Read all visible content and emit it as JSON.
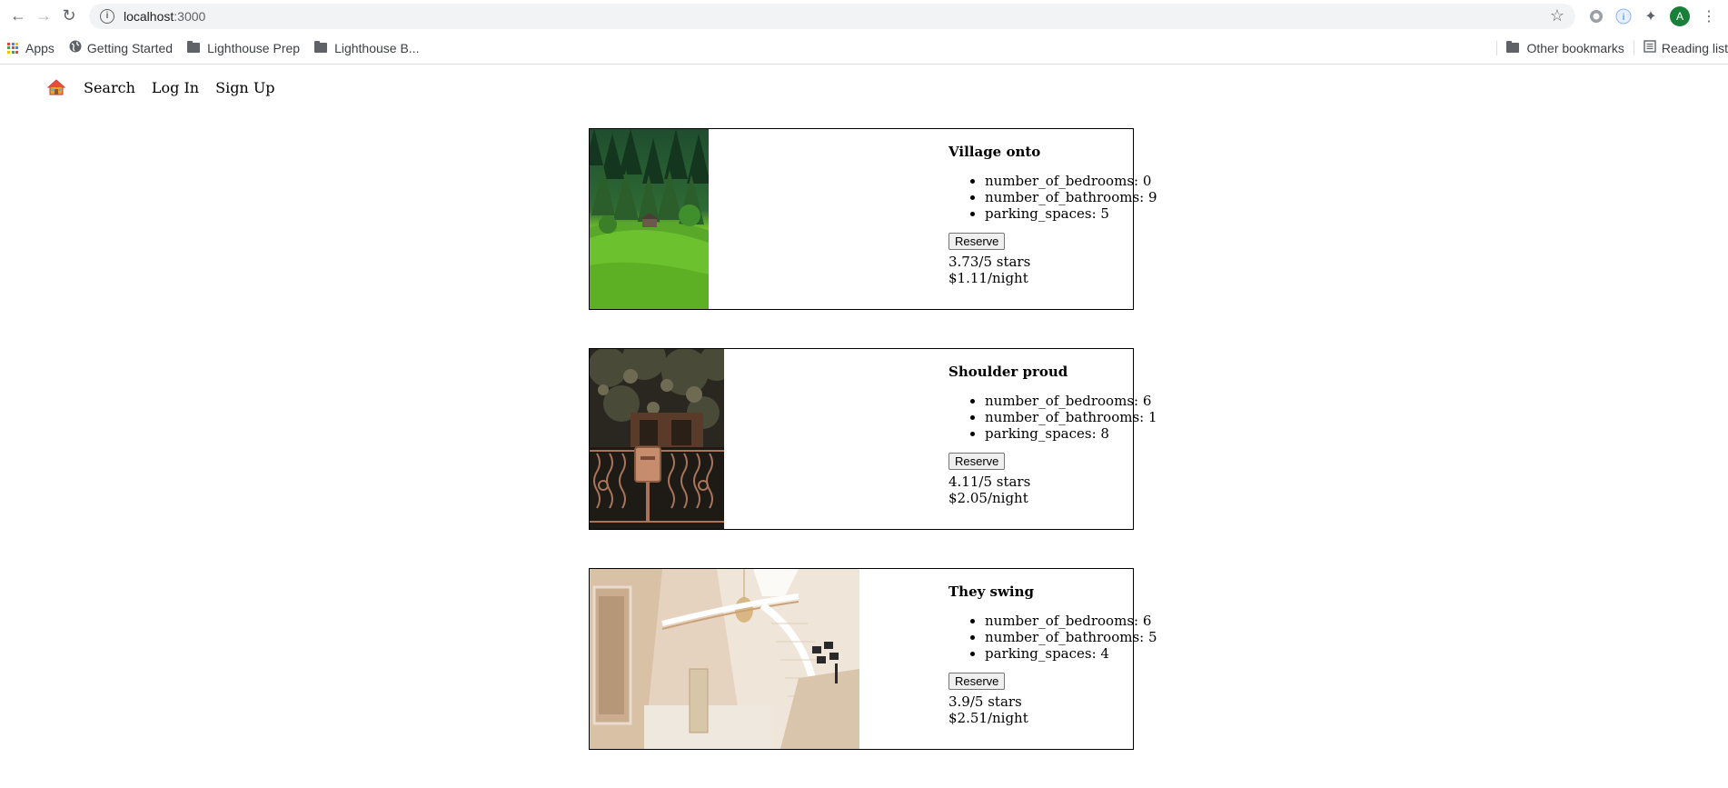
{
  "browser": {
    "url_host": "localhost",
    "url_port": ":3000",
    "avatar_letter": "A",
    "bookmarks": [
      {
        "label": "Apps",
        "icon": "apps-grid-icon"
      },
      {
        "label": "Getting Started",
        "icon": "globe-icon"
      },
      {
        "label": "Lighthouse Prep",
        "icon": "folder-icon"
      },
      {
        "label": "Lighthouse B...",
        "icon": "folder-icon"
      }
    ],
    "bookmarks_right": [
      {
        "label": "Other bookmarks",
        "icon": "folder-icon"
      },
      {
        "label": "Reading list",
        "icon": "reading-list-icon"
      }
    ]
  },
  "nav": {
    "items": [
      "Search",
      "Log In",
      "Sign Up"
    ]
  },
  "listings": [
    {
      "title": "Village onto",
      "features": [
        "number_of_bedrooms: 0",
        "number_of_bathrooms: 9",
        "parking_spaces: 5"
      ],
      "reserve_label": "Reserve",
      "rating": "3.73/5 stars",
      "price": "$1.11/night",
      "photo": "green-hillside-cabin-photo"
    },
    {
      "title": "Shoulder proud",
      "features": [
        "number_of_bedrooms: 6",
        "number_of_bathrooms: 1",
        "parking_spaces: 8"
      ],
      "reserve_label": "Reserve",
      "rating": "4.11/5 stars",
      "price": "$2.05/night",
      "photo": "iron-gate-mailbox-photo"
    },
    {
      "title": "They swing",
      "features": [
        "number_of_bedrooms: 6",
        "number_of_bathrooms: 5",
        "parking_spaces: 4"
      ],
      "reserve_label": "Reserve",
      "rating": "3.9/5 stars",
      "price": "$2.51/night",
      "photo": "spiral-staircase-foyer-photo"
    }
  ]
}
